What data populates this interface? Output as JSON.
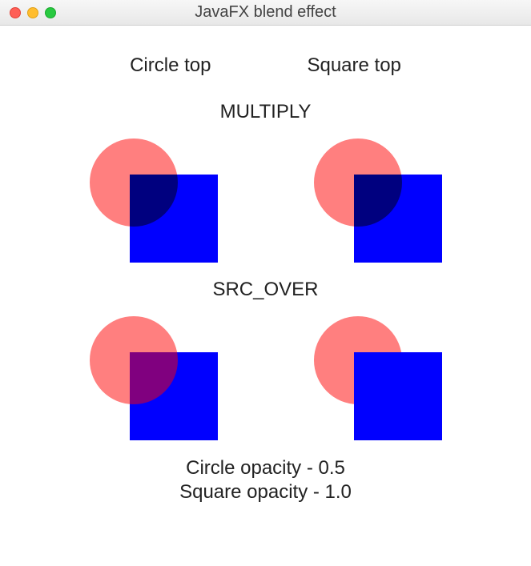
{
  "window": {
    "title": "JavaFX blend effect"
  },
  "headers": {
    "left": "Circle top",
    "right": "Square top"
  },
  "sections": {
    "multiply": "MULTIPLY",
    "src_over": "SRC_OVER"
  },
  "footer": {
    "line1": "Circle opacity - 0.5",
    "line2": "Square opacity - 1.0"
  },
  "shapes": {
    "circle_color": "#ff0000",
    "circle_opacity": 0.5,
    "square_color": "#0000ff",
    "square_opacity": 1.0
  }
}
